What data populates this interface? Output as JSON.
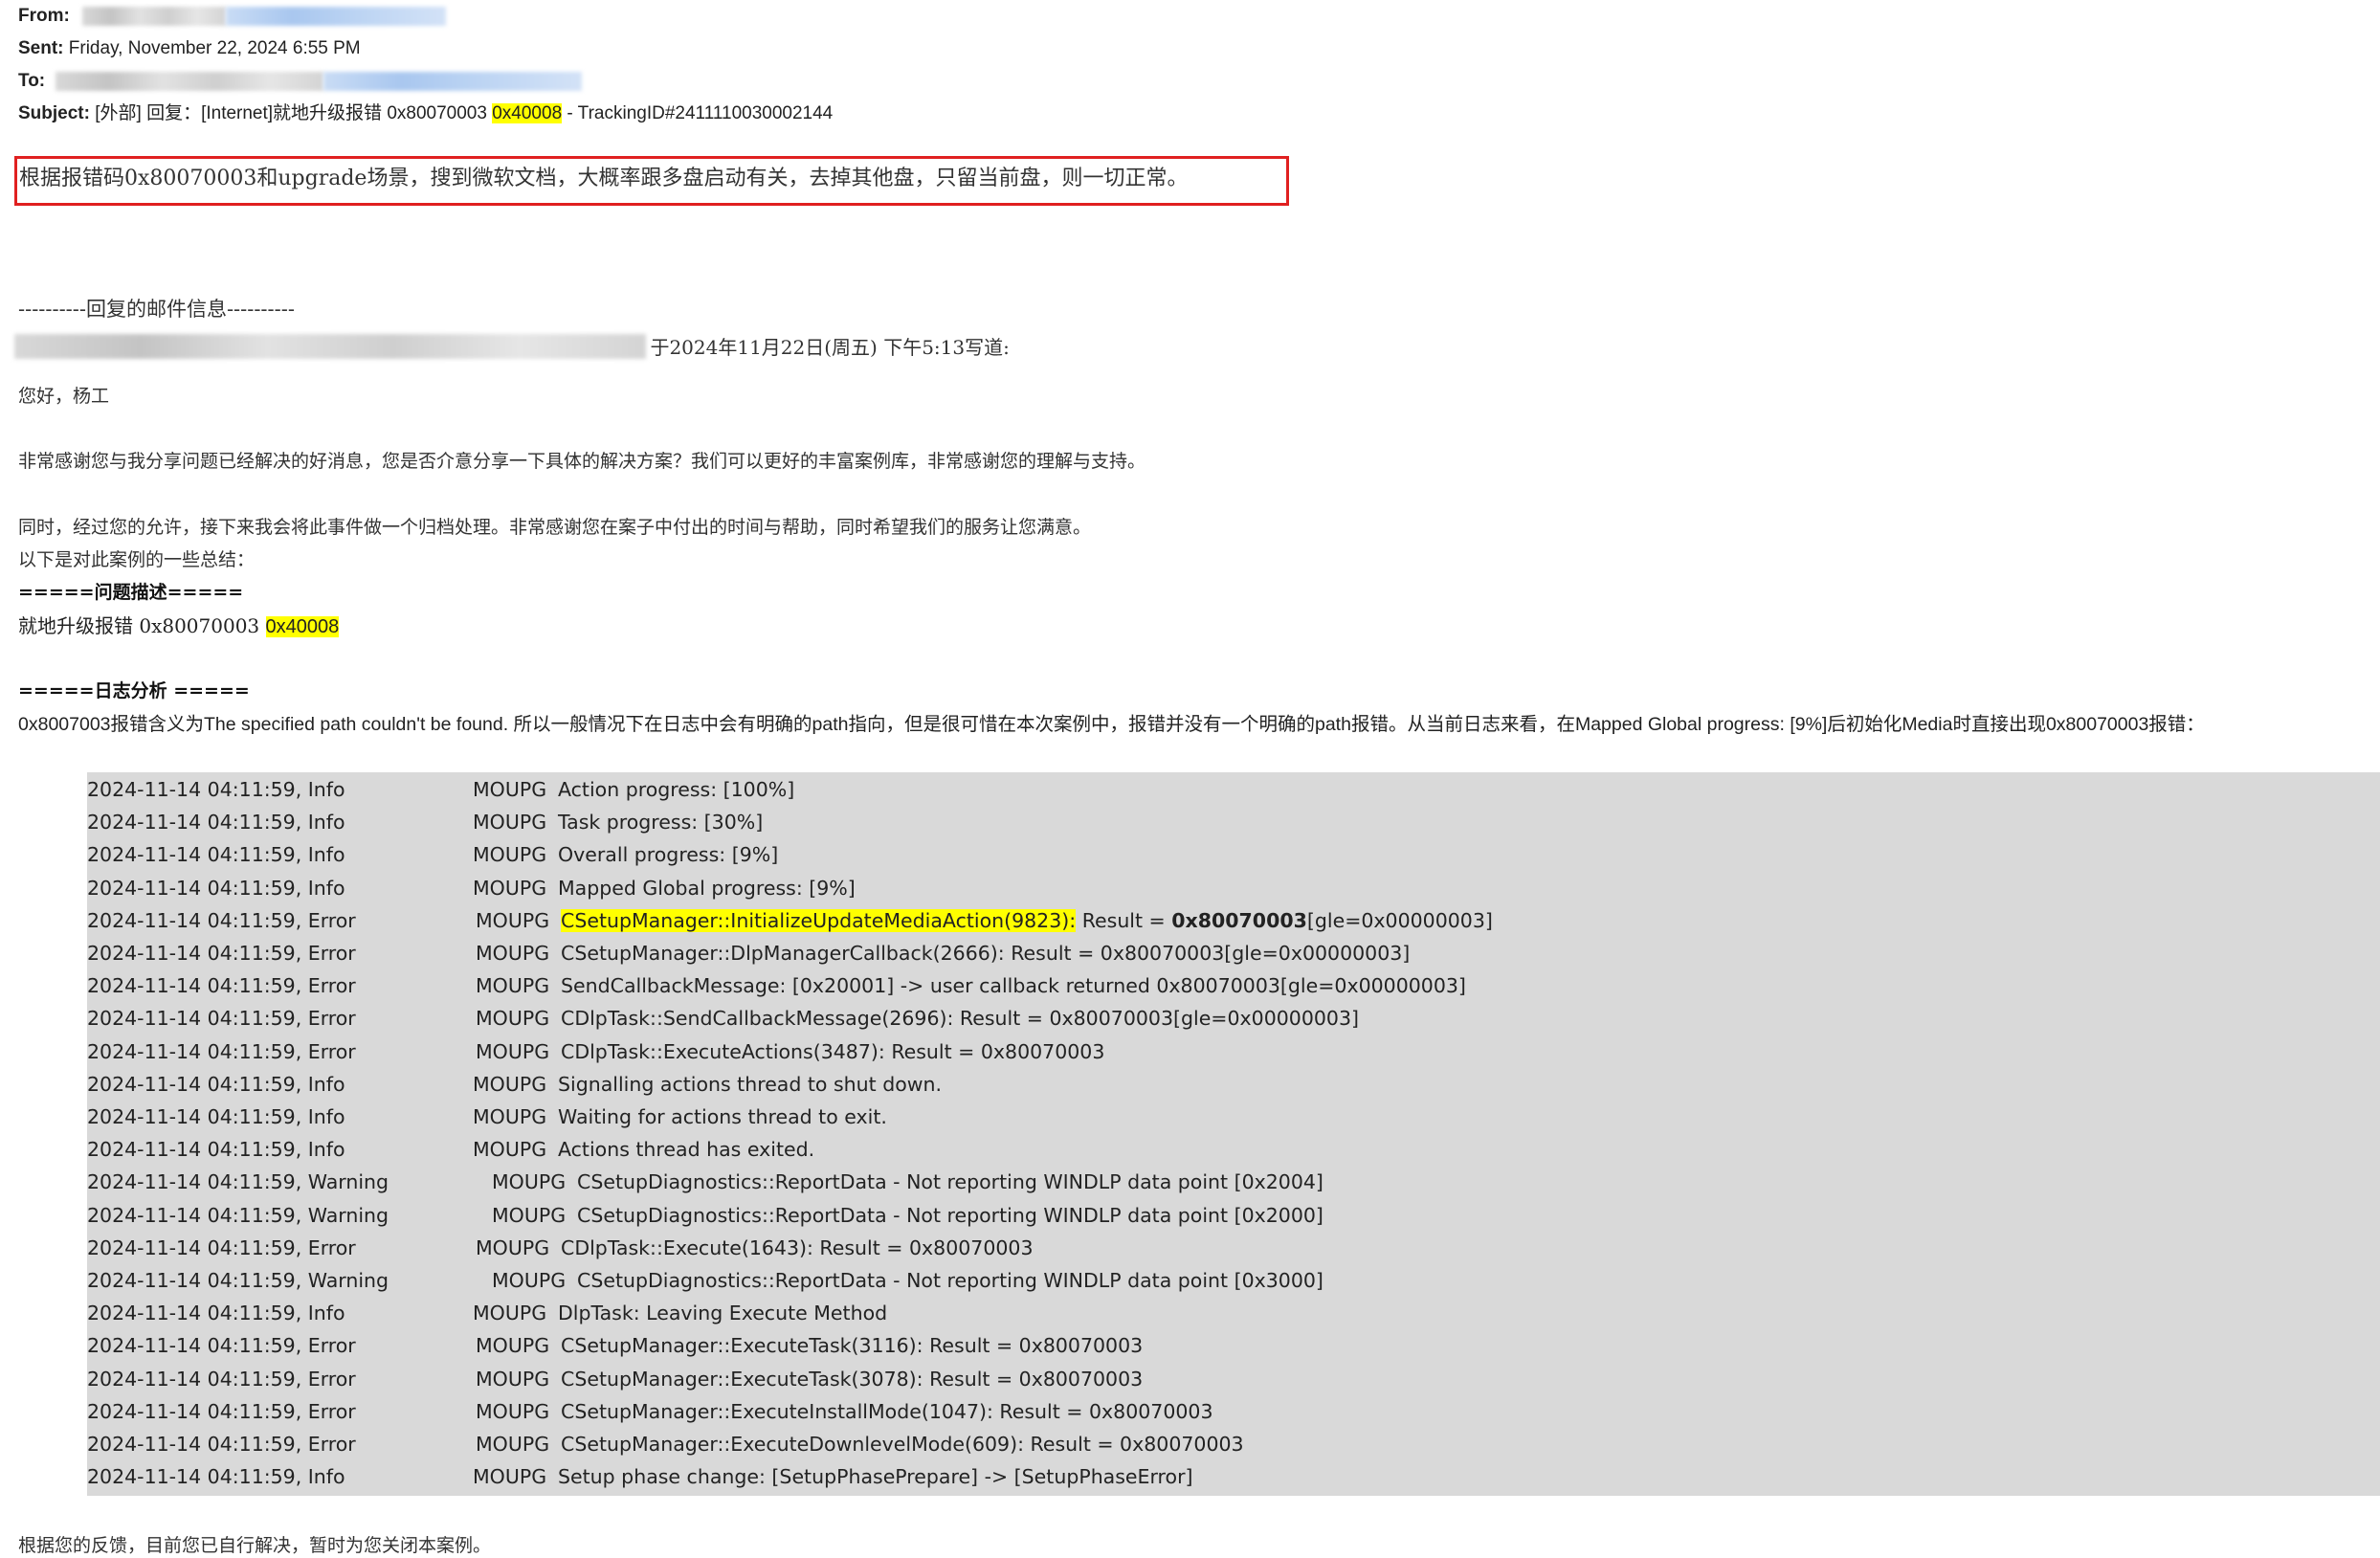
{
  "email": {
    "from_label": "From:",
    "sent_label": "Sent:",
    "sent_value": "Friday, November 22, 2024 6:55 PM",
    "to_label": "To:",
    "subject_label": "Subject:",
    "subject_prefix": "[外部] 回复：[Internet]就地升级报错 0x80070003 ",
    "subject_highlight": "0x40008",
    "subject_suffix": " - TrackingID#2411110030002144"
  },
  "reply": {
    "boxed_text": "根据报错码0x80070003和upgrade场景，搜到微软文档，大概率跟多盘启动有关，去掉其他盘，只留当前盘，则一切正常。",
    "separator": "----------回复的邮件信息----------",
    "quote_line": "于2024年11月22日(周五) 下午5:13写道:"
  },
  "body": {
    "greeting": "您好，杨工",
    "para1": "非常感谢您与我分享问题已经解决的好消息，您是否介意分享一下具体的解决方案？我们可以更好的丰富案例库，非常感谢您的理解与支持。",
    "para2": "同时，经过您的允许，接下来我会将此事件做一个归档处理。非常感谢您在案子中付出的时间与帮助，同时希望我们的服务让您满意。",
    "summary_intro": "以下是对此案例的一些总结：",
    "problem_heading": "=====问题描述=====",
    "problem_text": "就地升级报错 0x80070003 ",
    "problem_highlight": "0x40008",
    "log_heading": "=====日志分析 =====",
    "log_analysis": "0x8007003报错含义为The specified path couldn't be found. 所以一般情况下在日志中会有明确的path指向，但是很可惜在本次案例中，报错并没有一个明确的path报错。从当前日志来看，在Mapped Global progress: [9%]后初始化Media时直接出现0x80070003报错：",
    "closing": "根据您的反馈，目前您已自行解决，暂时为您关闭本案例。"
  },
  "log_rows": [
    {
      "ts": "2024-11-14 04:11:59, Info",
      "src": "MOUPG",
      "msg": "Action progress: [100%]"
    },
    {
      "ts": "2024-11-14 04:11:59, Info",
      "src": "MOUPG",
      "msg": "Task progress: [30%]"
    },
    {
      "ts": "2024-11-14 04:11:59, Info",
      "src": "MOUPG",
      "msg": "Overall progress: [9%]"
    },
    {
      "ts": "2024-11-14 04:11:59, Info",
      "src": "MOUPG",
      "msg": "Mapped Global progress: [9%]"
    },
    {
      "ts": "2024-11-14 04:11:59, Error",
      "src": "MOUPG",
      "hl": "CSetupManager::InitializeUpdateMediaAction(9823):",
      "msg": " Result = ",
      "bold": "0x80070003",
      "tail": "[gle=0x00000003]"
    },
    {
      "ts": "2024-11-14 04:11:59, Error",
      "src": "MOUPG",
      "msg": "CSetupManager::DlpManagerCallback(2666): Result = 0x80070003[gle=0x00000003]"
    },
    {
      "ts": "2024-11-14 04:11:59, Error",
      "src": "MOUPG",
      "msg": "SendCallbackMessage: [0x20001] -> user callback returned 0x80070003[gle=0x00000003]"
    },
    {
      "ts": "2024-11-14 04:11:59, Error",
      "src": "MOUPG",
      "msg": "CDlpTask::SendCallbackMessage(2696): Result = 0x80070003[gle=0x00000003]"
    },
    {
      "ts": "2024-11-14 04:11:59, Error",
      "src": "MOUPG",
      "msg": "CDlpTask::ExecuteActions(3487): Result = 0x80070003"
    },
    {
      "ts": "2024-11-14 04:11:59, Info",
      "src": "MOUPG",
      "msg": "Signalling actions thread to shut down."
    },
    {
      "ts": "2024-11-14 04:11:59, Info",
      "src": "MOUPG",
      "msg": "Waiting for actions thread to exit."
    },
    {
      "ts": "2024-11-14 04:11:59, Info",
      "src": "MOUPG",
      "msg": "Actions thread has exited."
    },
    {
      "ts": "2024-11-14 04:11:59, Warning",
      "src": "MOUPG",
      "msg": "CSetupDiagnostics::ReportData - Not reporting WINDLP data point [0x2004]"
    },
    {
      "ts": "2024-11-14 04:11:59, Warning",
      "src": "MOUPG",
      "msg": "CSetupDiagnostics::ReportData - Not reporting WINDLP data point [0x2000]"
    },
    {
      "ts": "2024-11-14 04:11:59, Error",
      "src": "MOUPG",
      "msg": "CDlpTask::Execute(1643): Result = 0x80070003"
    },
    {
      "ts": "2024-11-14 04:11:59, Warning",
      "src": "MOUPG",
      "msg": "CSetupDiagnostics::ReportData - Not reporting WINDLP data point [0x3000]"
    },
    {
      "ts": "2024-11-14 04:11:59, Info",
      "src": "MOUPG",
      "msg": "DlpTask: Leaving Execute Method"
    },
    {
      "ts": "2024-11-14 04:11:59, Error",
      "src": "MOUPG",
      "msg": "CSetupManager::ExecuteTask(3116): Result = 0x80070003"
    },
    {
      "ts": "2024-11-14 04:11:59, Error",
      "src": "MOUPG",
      "msg": "CSetupManager::ExecuteTask(3078): Result = 0x80070003"
    },
    {
      "ts": "2024-11-14 04:11:59, Error",
      "src": "MOUPG",
      "msg": "CSetupManager::ExecuteInstallMode(1047): Result = 0x80070003"
    },
    {
      "ts": "2024-11-14 04:11:59, Error",
      "src": "MOUPG",
      "msg": "CSetupManager::ExecuteDownlevelMode(609): Result = 0x80070003"
    },
    {
      "ts": "2024-11-14 04:11:59, Info",
      "src": "MOUPG",
      "msg": "Setup phase change: [SetupPhasePrepare] -> [SetupPhaseError]"
    }
  ],
  "colors": {
    "highlight": "#ffff00",
    "box_border": "#e02020",
    "log_background": "#d9d9d9"
  }
}
